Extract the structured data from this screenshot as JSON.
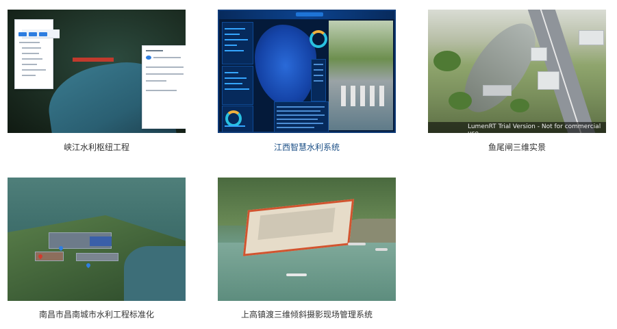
{
  "projects": [
    {
      "caption": "峡江水利枢纽工程",
      "active": false
    },
    {
      "caption": "江西智慧水利系统",
      "active": true
    },
    {
      "caption": "鱼尾闸三维实景",
      "active": false,
      "watermark": "LumenRT Trial Version - Not for commercial use"
    },
    {
      "caption": "南昌市昌南城市水利工程标准化",
      "active": false
    },
    {
      "caption": "上高镇渡三维倾斜摄影现场管理系统",
      "active": false
    }
  ]
}
